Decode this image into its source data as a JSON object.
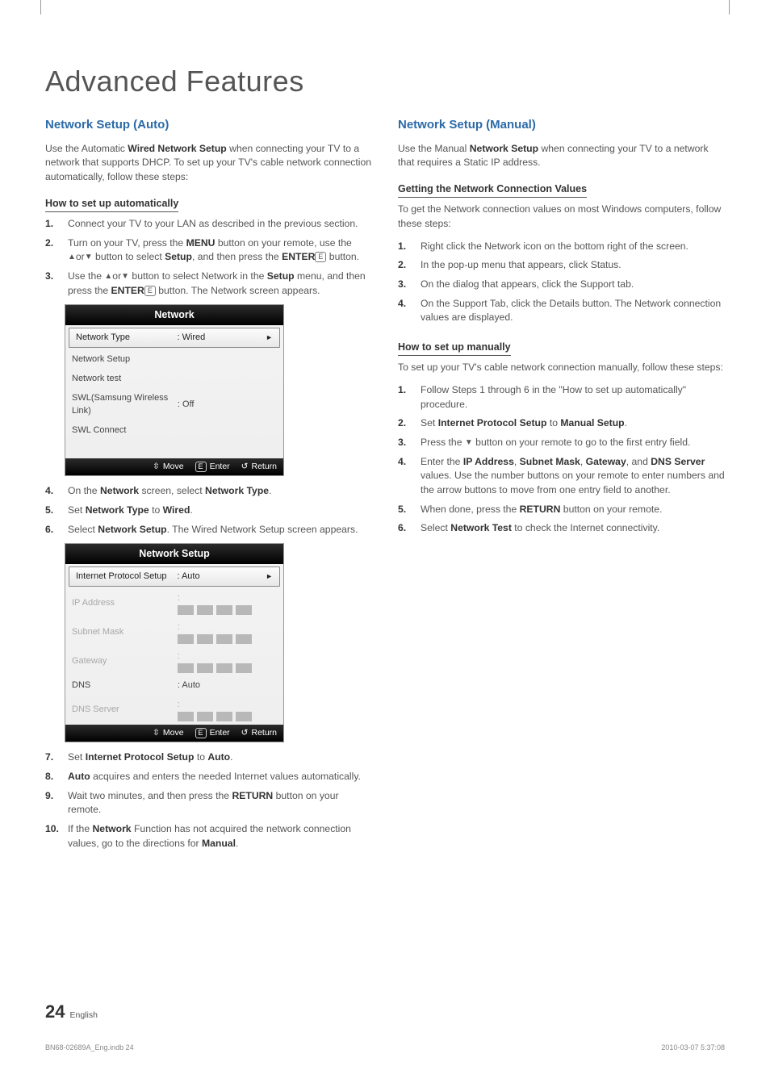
{
  "page_title": "Advanced Features",
  "footer": {
    "page_num": "24",
    "lang": "English",
    "doc_id": "BN68-02689A_Eng.indb   24",
    "timestamp": "2010-03-07     5:37:08"
  },
  "glyphs": {
    "up": "▲",
    "down": "▼",
    "right": "►",
    "updown": "⇳",
    "return": "↺",
    "enter": "E"
  },
  "menu_footer": {
    "move": "Move",
    "enter": "Enter",
    "return": "Return"
  },
  "left": {
    "heading": "Network Setup (Auto)",
    "intro_pre": "Use the Automatic ",
    "intro_bold": "Wired Network Setup",
    "intro_post": " when connecting your TV to a network that supports DHCP. To set up your TV's cable network connection automatically, follow these steps:",
    "sub1": "How to set up automatically",
    "steps_a": [
      {
        "n": "1.",
        "frags": [
          {
            "t": "Connect your TV to your LAN as described in the previous section."
          }
        ]
      },
      {
        "n": "2.",
        "frags": [
          {
            "t": "Turn on your TV, press the "
          },
          {
            "b": "MENU"
          },
          {
            "t": " button on your remote, use the "
          },
          {
            "sym": "up"
          },
          {
            "t": "or"
          },
          {
            "sym": "down"
          },
          {
            "t": " button to select "
          },
          {
            "b": "Setup"
          },
          {
            "t": ", and then press the "
          },
          {
            "b": "ENTER"
          },
          {
            "enter": true
          },
          {
            "t": " button."
          }
        ]
      },
      {
        "n": "3.",
        "frags": [
          {
            "t": "Use the "
          },
          {
            "sym": "up"
          },
          {
            "t": "or"
          },
          {
            "sym": "down"
          },
          {
            "t": " button to select Network in the "
          },
          {
            "b": "Setup"
          },
          {
            "t": " menu, and then press the "
          },
          {
            "b": "ENTER"
          },
          {
            "enter": true
          },
          {
            "t": " button. The Network screen appears."
          }
        ]
      }
    ],
    "menu1": {
      "title": "Network",
      "rows": [
        {
          "label": "Network Type",
          "value": ": Wired",
          "sel": true,
          "caret": true
        },
        {
          "label": "Network Setup"
        },
        {
          "label": "Network test"
        },
        {
          "label": "SWL(Samsung Wireless Link)",
          "value": ": Off"
        },
        {
          "label": "SWL Connect"
        }
      ]
    },
    "steps_b": [
      {
        "n": "4.",
        "frags": [
          {
            "t": "On the "
          },
          {
            "b": "Network"
          },
          {
            "t": " screen, select "
          },
          {
            "b": "Network Type"
          },
          {
            "t": "."
          }
        ]
      },
      {
        "n": "5.",
        "frags": [
          {
            "t": "Set "
          },
          {
            "b": "Network Type"
          },
          {
            "t": " to "
          },
          {
            "b": "Wired"
          },
          {
            "t": "."
          }
        ]
      },
      {
        "n": "6.",
        "frags": [
          {
            "t": "Select "
          },
          {
            "b": "Network Setup"
          },
          {
            "t": ". The Wired Network Setup screen appears."
          }
        ]
      }
    ],
    "menu2": {
      "title": "Network Setup",
      "rows": [
        {
          "label": "Internet Protocol Setup",
          "value": ": Auto",
          "sel": true,
          "caret": true
        },
        {
          "label": "IP Address",
          "ip": true,
          "dim": true
        },
        {
          "label": "Subnet Mask",
          "ip": true,
          "dim": true
        },
        {
          "label": "Gateway",
          "ip": true,
          "dim": true
        },
        {
          "label": "DNS",
          "value": ": Auto"
        },
        {
          "label": "DNS Server",
          "ip": true,
          "dim": true
        }
      ]
    },
    "steps_c": [
      {
        "n": "7.",
        "frags": [
          {
            "t": "Set "
          },
          {
            "b": "Internet Protocol Setup"
          },
          {
            "t": " to "
          },
          {
            "b": "Auto"
          },
          {
            "t": "."
          }
        ]
      },
      {
        "n": "8.",
        "frags": [
          {
            "b": "Auto"
          },
          {
            "t": " acquires and enters the needed Internet values automatically."
          }
        ]
      },
      {
        "n": "9.",
        "frags": [
          {
            "t": "Wait two minutes, and then press the "
          },
          {
            "b": "RETURN"
          },
          {
            "t": " button on your remote."
          }
        ]
      },
      {
        "n": "10.",
        "frags": [
          {
            "t": "If the "
          },
          {
            "b": "Network"
          },
          {
            "t": " Function has not acquired the network connection values, go to the directions for "
          },
          {
            "b": "Manual"
          },
          {
            "t": "."
          }
        ]
      }
    ]
  },
  "right": {
    "heading": "Network Setup (Manual)",
    "intro_pre": "Use the Manual ",
    "intro_bold": "Network Setup",
    "intro_post": " when connecting your TV to a network that requires a Static IP address.",
    "sub1": "Getting the Network Connection Values",
    "sub1_intro": "To get the Network connection values on most Windows computers, follow these steps:",
    "steps_a": [
      {
        "n": "1.",
        "frags": [
          {
            "t": "Right click the Network icon on the bottom right of the screen."
          }
        ]
      },
      {
        "n": "2.",
        "frags": [
          {
            "t": "In the pop-up menu that appears, click Status."
          }
        ]
      },
      {
        "n": "3.",
        "frags": [
          {
            "t": "On the dialog that appears, click the Support tab."
          }
        ]
      },
      {
        "n": "4.",
        "frags": [
          {
            "t": "On the Support Tab, click the Details button. The Network connection values are displayed."
          }
        ]
      }
    ],
    "sub2": "How to set up manually",
    "sub2_intro": "To set up your TV's cable network connection manually, follow these steps:",
    "steps_b": [
      {
        "n": "1.",
        "frags": [
          {
            "t": "Follow Steps 1 through 6 in the \"How to set up automatically\" procedure."
          }
        ]
      },
      {
        "n": "2.",
        "frags": [
          {
            "t": "Set "
          },
          {
            "b": "Internet Protocol Setup"
          },
          {
            "t": " to "
          },
          {
            "b": "Manual Setup"
          },
          {
            "t": "."
          }
        ]
      },
      {
        "n": "3.",
        "frags": [
          {
            "t": "Press the "
          },
          {
            "sym": "down"
          },
          {
            "t": " button on your remote to go to the first entry field."
          }
        ]
      },
      {
        "n": "4.",
        "frags": [
          {
            "t": "Enter the "
          },
          {
            "b": "IP Address"
          },
          {
            "t": ", "
          },
          {
            "b": "Subnet Mask"
          },
          {
            "t": ", "
          },
          {
            "b": "Gateway"
          },
          {
            "t": ", and "
          },
          {
            "b": "DNS Server"
          },
          {
            "t": " values. Use the number buttons on your remote to enter numbers and the arrow buttons to move from one entry field to another."
          }
        ]
      },
      {
        "n": "5.",
        "frags": [
          {
            "t": "When done, press the "
          },
          {
            "b": "RETURN"
          },
          {
            "t": " button on your remote."
          }
        ]
      },
      {
        "n": "6.",
        "frags": [
          {
            "t": "Select "
          },
          {
            "b": "Network Test"
          },
          {
            "t": " to check the Internet connectivity."
          }
        ]
      }
    ]
  }
}
